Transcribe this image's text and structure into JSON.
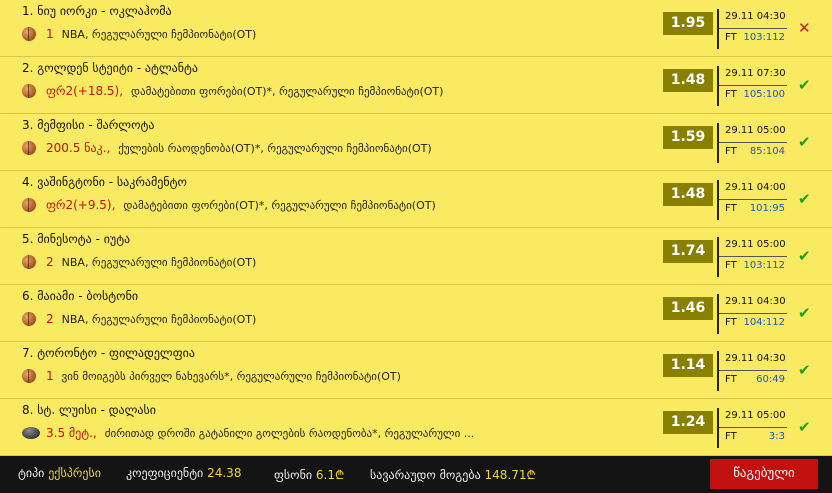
{
  "bets": [
    {
      "title": "1. ნიუ იორკი - ოკლაჰომა",
      "icon": "basketball-icon",
      "pick": "1",
      "description": "NBA, რეგულარული ჩემპიონატი(OT)",
      "odds": "1.95",
      "datetime": "29.11 04:30",
      "status_label": "FT",
      "score": "103:112",
      "result": "loss",
      "result_symbol": "✕"
    },
    {
      "title": "2. გოლდენ სტეიტი - ატლანტა",
      "icon": "basketball-icon",
      "pick": "ფრ2(+18.5),",
      "description": "დამატებითი ფორები(OT)*, რეგულარული ჩემპიონატი(OT)",
      "odds": "1.48",
      "datetime": "29.11 07:30",
      "status_label": "FT",
      "score": "105:100",
      "result": "win",
      "result_symbol": "✔"
    },
    {
      "title": "3. მემფისი - შარლოტა",
      "icon": "basketball-icon",
      "pick": "200.5 ნაკ.,",
      "description": "ქულების რაოდენობა(OT)*, რეგულარული ჩემპიონატი(OT)",
      "odds": "1.59",
      "datetime": "29.11 05:00",
      "status_label": "FT",
      "score": "85:104",
      "result": "win",
      "result_symbol": "✔"
    },
    {
      "title": "4. ვაშინგტონი - საკრამენტო",
      "icon": "basketball-icon",
      "pick": "ფრ2(+9.5),",
      "description": "დამატებითი ფორები(OT)*, რეგულარული ჩემპიონატი(OT)",
      "odds": "1.48",
      "datetime": "29.11 04:00",
      "status_label": "FT",
      "score": "101:95",
      "result": "win",
      "result_symbol": "✔"
    },
    {
      "title": "5. მინესოტა - იუტა",
      "icon": "basketball-icon",
      "pick": "2",
      "description": "NBA, რეგულარული ჩემპიონატი(OT)",
      "odds": "1.74",
      "datetime": "29.11 05:00",
      "status_label": "FT",
      "score": "103:112",
      "result": "win",
      "result_symbol": "✔"
    },
    {
      "title": "6. მაიამი - ბოსტონი",
      "icon": "basketball-icon",
      "pick": "2",
      "description": "NBA, რეგულარული ჩემპიონატი(OT)",
      "odds": "1.46",
      "datetime": "29.11 04:30",
      "status_label": "FT",
      "score": "104:112",
      "result": "win",
      "result_symbol": "✔"
    },
    {
      "title": "7. ტორონტო - ფილადელფია",
      "icon": "basketball-icon",
      "pick": "1",
      "description": "ვინ მოიგებს პირველ ნახევარს*, რეგულარული ჩემპიონატი(OT)",
      "odds": "1.14",
      "datetime": "29.11 04:30",
      "status_label": "FT",
      "score": "60:49",
      "result": "win",
      "result_symbol": "✔"
    },
    {
      "title": "8. სტ. ლუისი - დალასი",
      "icon": "hockey-puck-icon",
      "pick": "3.5 მეტ.,",
      "description": "ძირითად დროში გატანილი გოლების რაოდენობა*, რეგულარული ...",
      "odds": "1.24",
      "datetime": "29.11 05:00",
      "status_label": "FT",
      "score": "3:3",
      "result": "win",
      "result_symbol": "✔"
    }
  ],
  "footer": {
    "type_label": "ტიპი",
    "type_value": "ექსპრესი",
    "coef_label": "კოეფიციენტი",
    "coef_value": "24.38",
    "stake_label": "ფსონი",
    "stake_value": "6.1₾",
    "payout_label": "სავარაუდო მოგება",
    "payout_value": "148.71₾",
    "button_label": "წაგებული"
  },
  "colors": {
    "background": "#faea62",
    "odds_box": "#8a8000",
    "pick_text": "#c0140c",
    "score_text": "#1a55c8",
    "win": "#1e9e1e",
    "loss": "#d21818",
    "footer_bg": "#141414",
    "button": "#c40f0f"
  }
}
